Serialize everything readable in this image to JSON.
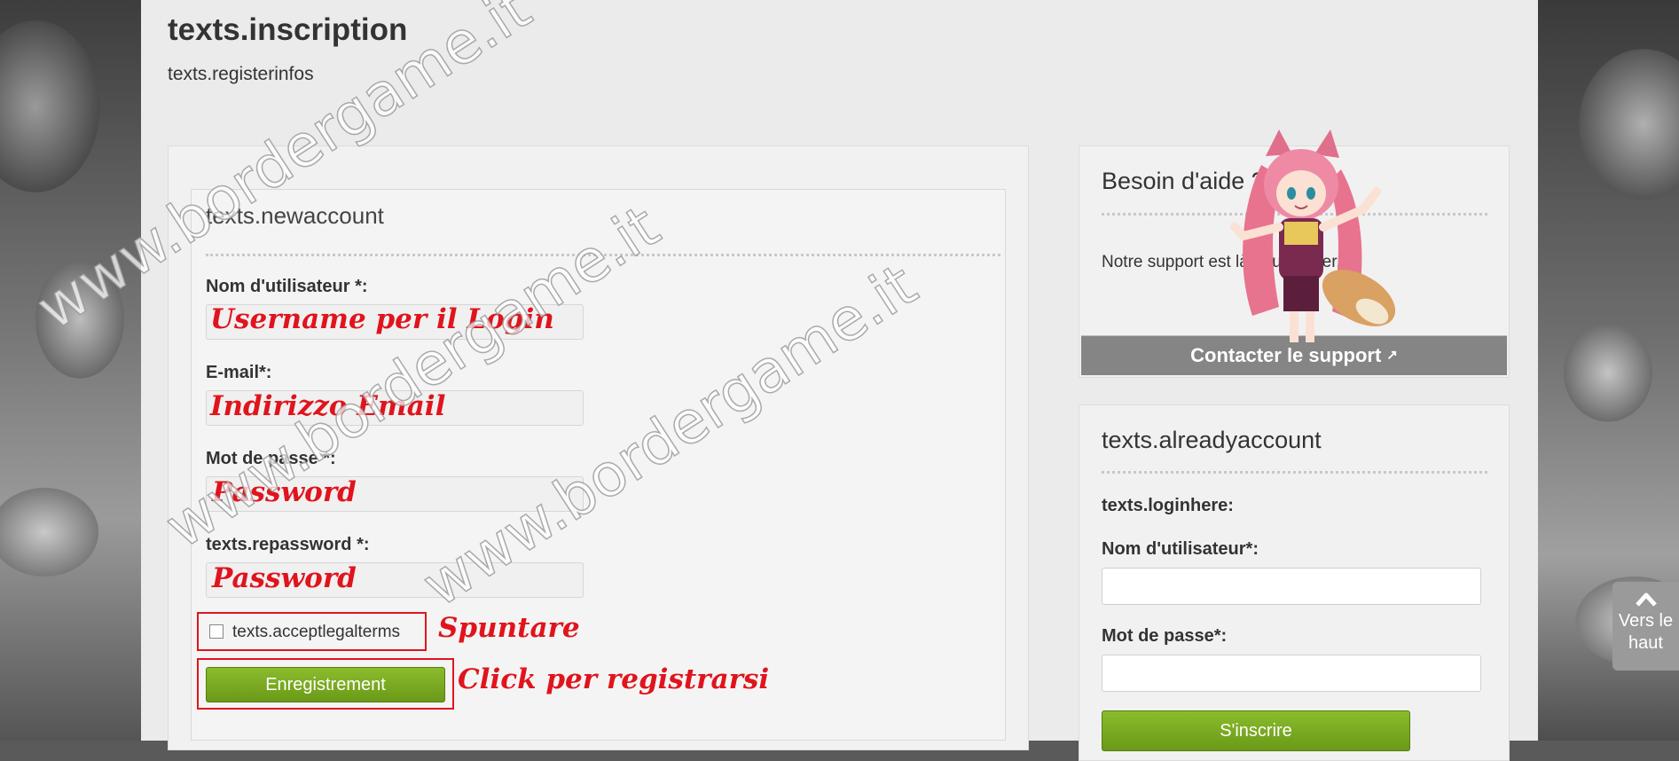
{
  "page": {
    "title": "texts.inscription",
    "subtitle": "texts.registerinfos"
  },
  "register_form": {
    "section_title": "texts.newaccount",
    "username_label": "Nom d'utilisateur *:",
    "email_label": "E-mail*:",
    "password_label": "Mot de passe *:",
    "repassword_label": "texts.repassword *:",
    "terms_label": "texts.acceptlegalterms",
    "terms_checked": false,
    "submit_label": "Enregistrement"
  },
  "annotations": {
    "username": "Username per il Login",
    "email": "Indirizzo Email",
    "password": "Password",
    "repassword": "Password",
    "checkbox": "Spuntare",
    "submit": "Click per registrarsi"
  },
  "help_panel": {
    "title": "Besoin d'aide ?",
    "text": "Notre support est là pour t'aider.",
    "button_label": "Contacter le support"
  },
  "login_panel": {
    "title": "texts.alreadyaccount",
    "hint": "texts.loginhere:",
    "username_label": "Nom d'utilisateur*:",
    "password_label": "Mot de passe*:",
    "signup_label": "S'inscrire"
  },
  "back_to_top": {
    "line1": "Vers le",
    "line2": "haut",
    "icon": "chevron-up-icon"
  },
  "watermark": "www.bordergame.it",
  "colors": {
    "annotation_red": "#e0141d",
    "button_green": "#7aaa22",
    "support_button_gray": "#858585",
    "page_bg": "#ebebeb"
  }
}
